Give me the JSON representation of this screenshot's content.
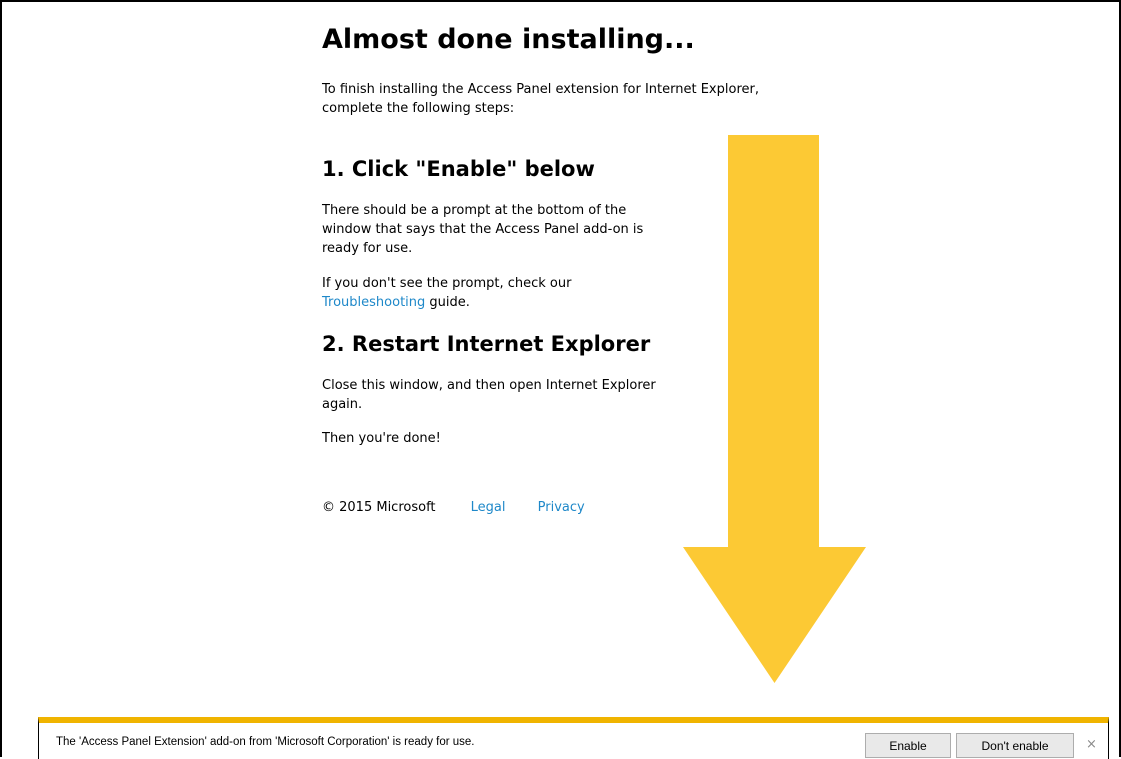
{
  "page": {
    "title": "Almost done installing...",
    "intro": "To finish installing the Access Panel extension for Internet Explorer, complete the following steps:",
    "step1": {
      "heading": "1. Click \"Enable\" below",
      "para1": "There should be a prompt at the bottom of the window that says that the Access Panel add-on is ready for use.",
      "para2_before": "If you don't see the prompt, check our ",
      "para2_link": "Troubleshooting",
      "para2_after": " guide."
    },
    "step2": {
      "heading": "2. Restart Internet Explorer",
      "para1": "Close this window, and then open Internet Explorer again.",
      "para2": "Then you're done!"
    },
    "footer": {
      "copyright": "© 2015 Microsoft",
      "legal": "Legal",
      "privacy": "Privacy"
    }
  },
  "notification_bar": {
    "message": "The 'Access Panel Extension' add-on from 'Microsoft Corporation' is ready for use.",
    "enable_label": "Enable",
    "dont_enable_label": "Don't enable",
    "close_glyph": "×"
  },
  "colors": {
    "link": "#1e88c9",
    "arrow": "#fcc934",
    "notification_accent": "#f0b400"
  },
  "icons": {
    "arrow": "down-arrow-icon",
    "close": "close-icon"
  }
}
